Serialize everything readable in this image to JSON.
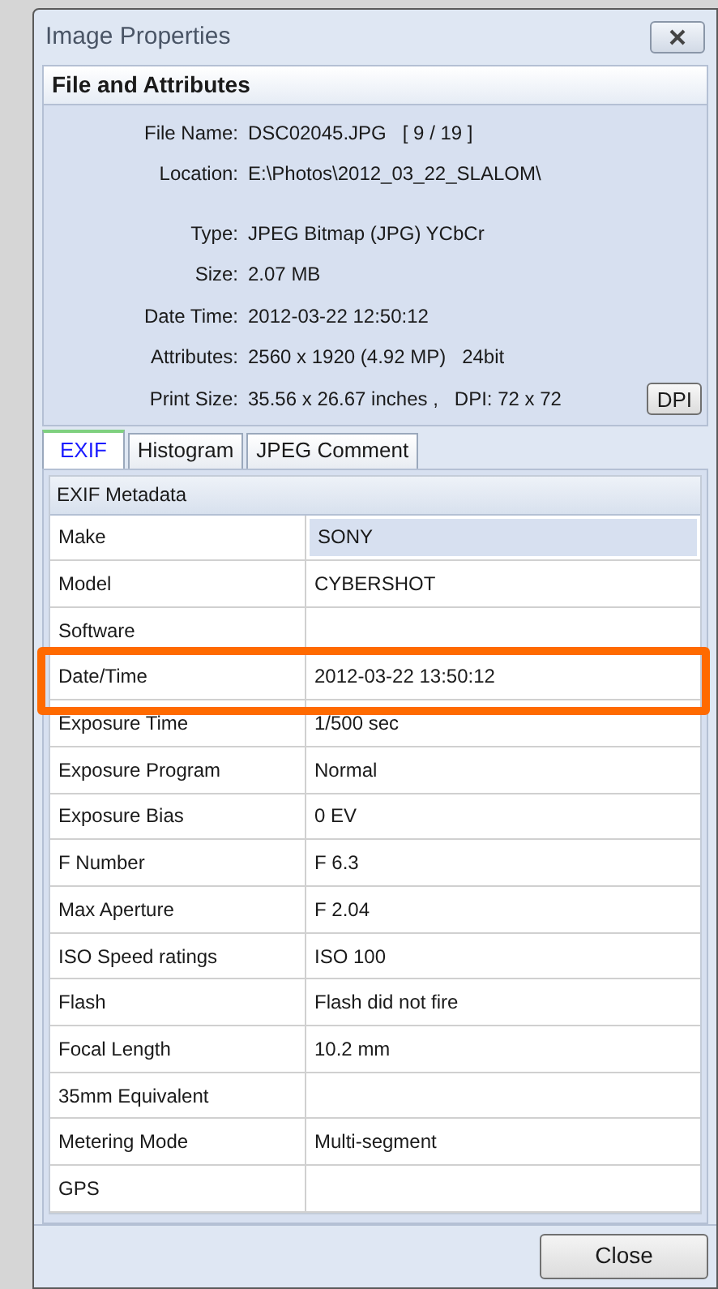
{
  "window": {
    "title": "Image Properties"
  },
  "file_section": {
    "title": "File and Attributes",
    "fields": [
      {
        "label": "File Name:",
        "value": "DSC02045.JPG",
        "extra": "[ 9 / 19 ]"
      },
      {
        "label": "Location:",
        "value": "E:\\Photos\\2012_03_22_SLALOM\\"
      },
      {
        "label": "Type:",
        "value": "JPEG Bitmap (JPG) YCbCr"
      },
      {
        "label": "Size:",
        "value": "2.07 MB"
      },
      {
        "label": "Date Time:",
        "value": "2012-03-22 12:50:12"
      },
      {
        "label": "Attributes:",
        "value": "2560 x 1920 (4.92 MP)",
        "extra": "24bit"
      },
      {
        "label": "Print Size:",
        "value": "35.56 x 26.67 inches ,",
        "extra": "DPI: 72 x 72"
      }
    ],
    "dpi_button": "DPI"
  },
  "tabs": [
    {
      "label": "EXIF",
      "selected": true
    },
    {
      "label": "Histogram",
      "selected": false
    },
    {
      "label": "JPEG Comment",
      "selected": false
    }
  ],
  "table": {
    "title": "EXIF Metadata",
    "rows": [
      {
        "name": "Make",
        "value": "SONY",
        "selected": true
      },
      {
        "name": "Model",
        "value": "CYBERSHOT",
        "selected": false
      },
      {
        "name": "Software",
        "selected": false
      },
      {
        "name": "Date/Time",
        "value": "2012-03-22 13:50:12",
        "selected": false,
        "highlighted": true
      },
      {
        "name": "Exposure Time",
        "value": "1/500 sec",
        "selected": false
      },
      {
        "name": "Exposure Program",
        "value": "Normal",
        "selected": false
      },
      {
        "name": "Exposure Bias",
        "value": "0 EV",
        "selected": false
      },
      {
        "name": "F Number",
        "value": "F 6.3",
        "selected": false
      },
      {
        "name": "Max Aperture",
        "value": "F 2.04",
        "selected": false
      },
      {
        "name": "ISO Speed ratings",
        "value": "ISO 100",
        "selected": false
      },
      {
        "name": "Flash",
        "value": "Flash did not fire",
        "selected": false
      },
      {
        "name": "Focal Length",
        "value": "10.2 mm",
        "selected": false
      },
      {
        "name": "35mm Equivalent",
        "selected": false
      },
      {
        "name": "Metering Mode",
        "value": "Multi-segment",
        "selected": false
      },
      {
        "name": "GPS",
        "selected": false
      }
    ]
  },
  "close_button": "Close"
}
